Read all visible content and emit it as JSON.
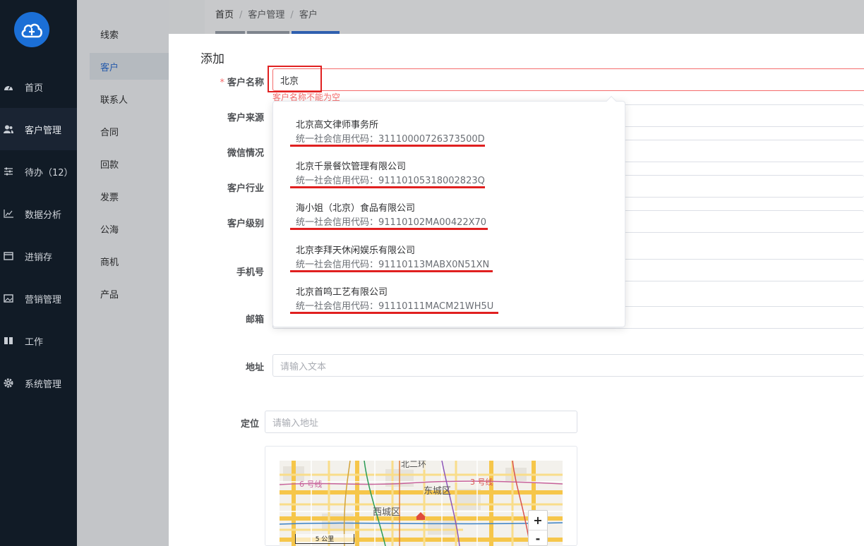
{
  "nav": {
    "items": [
      {
        "label": "首页",
        "icon": "dashboard-icon"
      },
      {
        "label": "客户管理",
        "icon": "users-icon"
      },
      {
        "label": "待办（12）",
        "icon": "sliders-icon"
      },
      {
        "label": "数据分析",
        "icon": "chart-icon"
      },
      {
        "label": "进销存",
        "icon": "box-icon"
      },
      {
        "label": "营销管理",
        "icon": "image-icon"
      },
      {
        "label": "工作",
        "icon": "book-icon"
      },
      {
        "label": "系统管理",
        "icon": "gear-icon"
      }
    ]
  },
  "submenu": {
    "items": [
      "线索",
      "客户",
      "联系人",
      "合同",
      "回款",
      "发票",
      "公海",
      "商机",
      "产品"
    ]
  },
  "breadcrumb": {
    "home": "首页",
    "section": "客户管理",
    "page": "客户"
  },
  "dialog": {
    "title": "添加",
    "labels": {
      "name": "客户名称",
      "source": "客户来源",
      "wechat": "微信情况",
      "industry": "客户行业",
      "level": "客户级别",
      "phone": "手机号",
      "email": "邮箱",
      "address": "地址",
      "location": "定位"
    },
    "name_value": "北京",
    "name_error": "客户名称不能为空",
    "address_placeholder": "请输入文本",
    "location_placeholder": "请输入地址"
  },
  "suggestions": [
    {
      "name": "北京高文律师事务所",
      "code": "统一社会信用代码：31110000726373500D"
    },
    {
      "name": "北京千景餐饮管理有限公司",
      "code": "统一社会信用代码：91110105318002823Q"
    },
    {
      "name": "海小姐（北京）食品有限公司",
      "code": "统一社会信用代码：91110102MA00422X70"
    },
    {
      "name": "北京李拜天休闲娱乐有限公司",
      "code": "统一社会信用代码：91110113MABX0N51XN"
    },
    {
      "name": "北京首鸣工艺有限公司",
      "code": "统一社会信用代码：91110111MACM21WH5U"
    }
  ],
  "map": {
    "labels": {
      "line6": "6 号线",
      "line3": "3 号线",
      "dongcheng": "东城区",
      "xicheng": "西城区",
      "ring": "北二环",
      "scale": "5 公里"
    },
    "zoom_in": "+",
    "zoom_out": "-"
  },
  "colors": {
    "sidebar": "#111b26",
    "accent": "#2f6fd1",
    "error": "#f56c6c",
    "annotation": "#e02020"
  }
}
